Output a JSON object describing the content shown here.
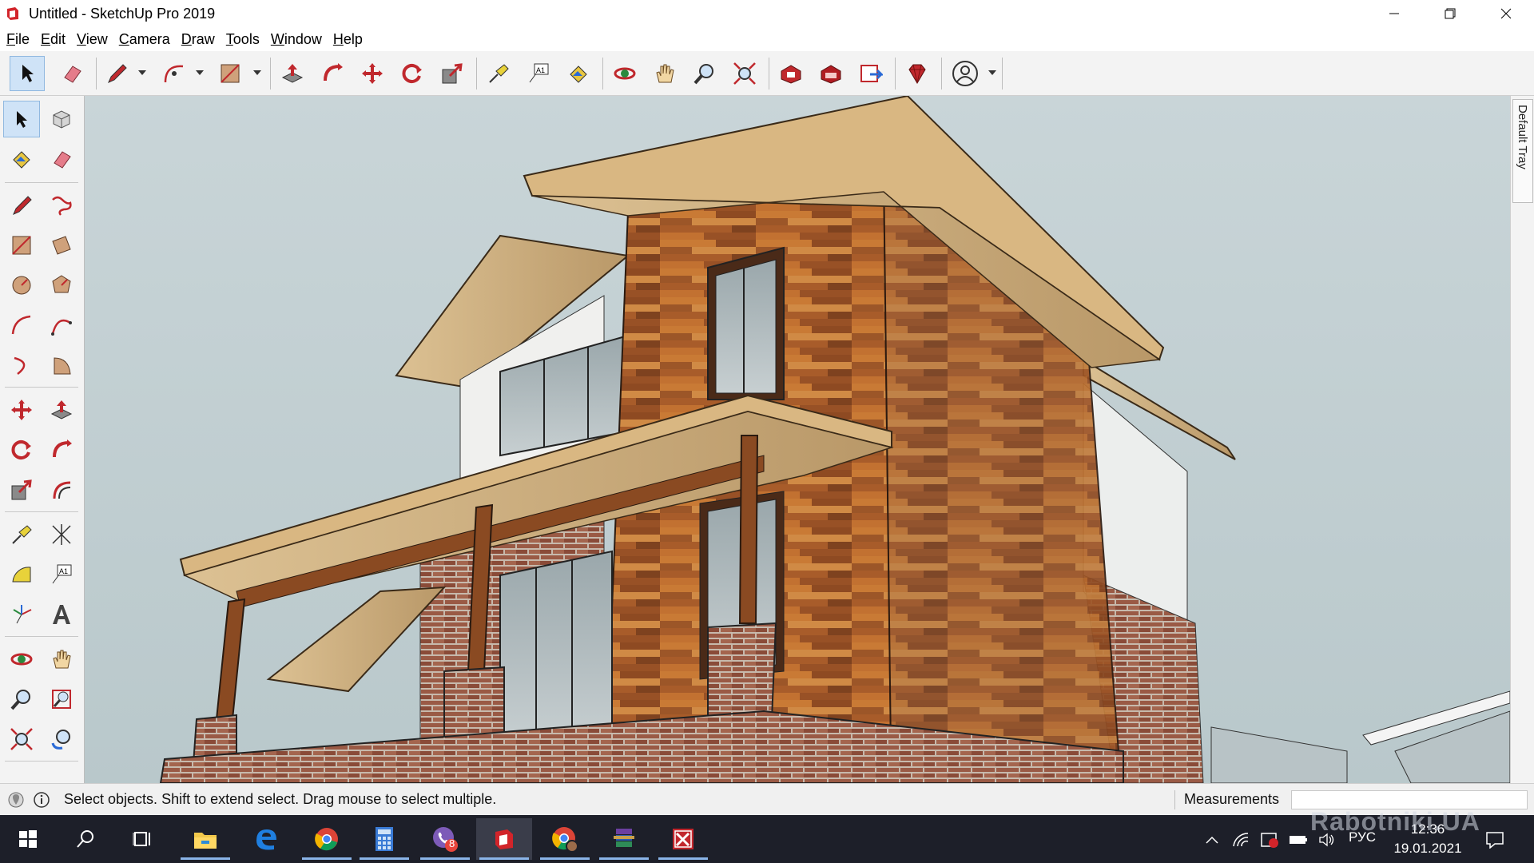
{
  "window": {
    "title": "Untitled - SketchUp Pro 2019"
  },
  "menu": [
    "File",
    "Edit",
    "View",
    "Camera",
    "Draw",
    "Tools",
    "Window",
    "Help"
  ],
  "toolbar_icons": [
    "select-icon",
    "eraser-icon",
    "pencil-icon",
    "arc-icon",
    "rectangle-icon",
    "push-pull-icon",
    "follow-me-icon",
    "move-icon",
    "rotate-icon",
    "scale-icon",
    "tape-measure-icon",
    "text-icon",
    "paint-bucket-icon",
    "orbit-icon",
    "pan-icon",
    "zoom-icon",
    "zoom-extents-icon",
    "warehouse-icon",
    "extension-warehouse-icon",
    "send-to-layout-icon",
    "extension-manager-icon",
    "account-icon"
  ],
  "left_tool_icons": [
    "select-icon",
    "component-icon",
    "paint-bucket-icon",
    "eraser-icon",
    "line-icon",
    "freehand-icon",
    "rectangle-icon",
    "rotated-rectangle-icon",
    "circle-icon",
    "polygon-icon",
    "arc-icon",
    "two-point-arc-icon",
    "three-point-arc-icon",
    "pie-icon",
    "move-icon",
    "push-pull-icon",
    "rotate-icon",
    "follow-me-icon",
    "scale-icon",
    "offset-icon",
    "tape-measure-icon",
    "dimension-icon",
    "protractor-icon",
    "text-icon",
    "axes-icon",
    "3d-text-icon",
    "orbit-icon",
    "pan-icon",
    "zoom-icon",
    "zoom-window-icon",
    "zoom-extents-icon",
    "previous-view-icon"
  ],
  "tray": {
    "label": "Default Tray"
  },
  "status": {
    "hint": "Select objects. Shift to extend select. Drag mouse to select multiple.",
    "measurements_label": "Measurements",
    "measurements_value": ""
  },
  "taskbar": {
    "apps": [
      "start-icon",
      "search-icon",
      "task-view-icon",
      "file-explorer-icon",
      "edge-icon",
      "chrome-icon",
      "calculator-icon",
      "viber-icon",
      "sketchup-icon",
      "chrome-profile-icon",
      "winrar-icon",
      "snipping-icon"
    ],
    "viber_badge": "8",
    "language": "РУС",
    "time": "12:36",
    "date": "19.01.2021"
  },
  "watermark": "Rabotniki.UA",
  "colors": {
    "sky": "#c3d0d3",
    "wood": "#b4652a",
    "brick": "#9a5a45",
    "trim": "#d9b782",
    "taskbar": "#1d1f29",
    "accent_red": "#d2242a"
  }
}
